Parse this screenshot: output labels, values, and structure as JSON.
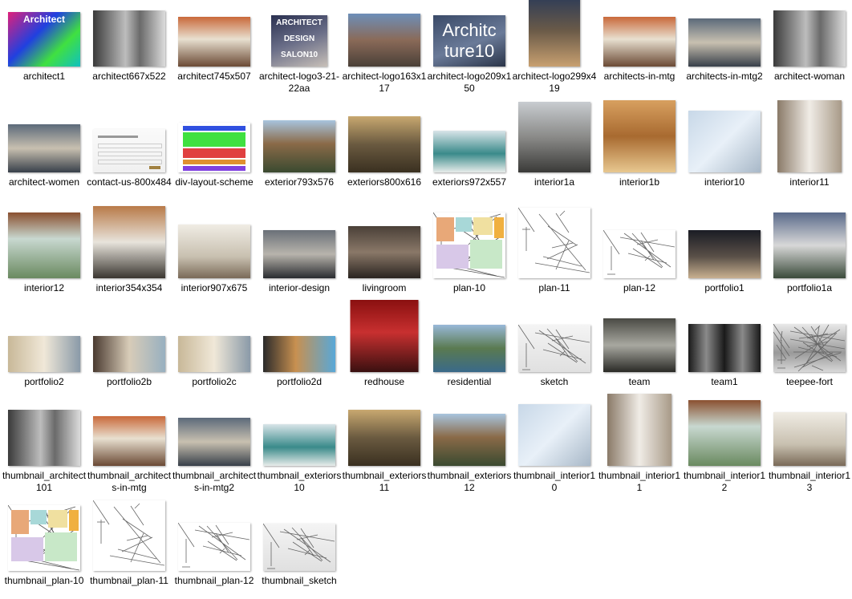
{
  "files": [
    {
      "name": "architect1",
      "kind": "neon"
    },
    {
      "name": "architect667x522",
      "kind": "bw"
    },
    {
      "name": "architect745x507",
      "kind": "office"
    },
    {
      "name": "architect-logo3-21-22aa",
      "kind": "logo3"
    },
    {
      "name": "architect-logo163x117",
      "kind": "city"
    },
    {
      "name": "architect-logo209x150",
      "kind": "logo20"
    },
    {
      "name": "architect-logo299x419",
      "kind": "tallhouse"
    },
    {
      "name": "architects-in-mtg",
      "kind": "office"
    },
    {
      "name": "architects-in-mtg2",
      "kind": "meeting"
    },
    {
      "name": "architect-woman",
      "kind": "bw"
    },
    {
      "name": "architect-women",
      "kind": "meeting"
    },
    {
      "name": "contact-us-800x484",
      "kind": "form"
    },
    {
      "name": "div-layout-scheme",
      "kind": "layout"
    },
    {
      "name": "exterior793x576",
      "kind": "exterior"
    },
    {
      "name": "exteriors800x616",
      "kind": "cabin"
    },
    {
      "name": "exteriors972x557",
      "kind": "teal"
    },
    {
      "name": "interior1a",
      "kind": "living"
    },
    {
      "name": "interior1b",
      "kind": "warm"
    },
    {
      "name": "interior10",
      "kind": "lightwall"
    },
    {
      "name": "interior11",
      "kind": "corridor"
    },
    {
      "name": "interior12",
      "kind": "balcony"
    },
    {
      "name": "interior354x354",
      "kind": "kitchen"
    },
    {
      "name": "interior907x675",
      "kind": "dining"
    },
    {
      "name": "interior-design",
      "kind": "sofa"
    },
    {
      "name": "livingroom",
      "kind": "fireplace"
    },
    {
      "name": "plan-10",
      "kind": "plancolor"
    },
    {
      "name": "plan-11",
      "kind": "section"
    },
    {
      "name": "plan-12",
      "kind": "plan"
    },
    {
      "name": "portfolio1",
      "kind": "nighthouse"
    },
    {
      "name": "portfolio1a",
      "kind": "modernhouse"
    },
    {
      "name": "portfolio2",
      "kind": "bedroom"
    },
    {
      "name": "portfolio2b",
      "kind": "bedroom2"
    },
    {
      "name": "portfolio2c",
      "kind": "bedroom"
    },
    {
      "name": "portfolio2d",
      "kind": "pool"
    },
    {
      "name": "redhouse",
      "kind": "red"
    },
    {
      "name": "residential",
      "kind": "lake"
    },
    {
      "name": "sketch",
      "kind": "sketch"
    },
    {
      "name": "team",
      "kind": "forest"
    },
    {
      "name": "team1",
      "kind": "faces"
    },
    {
      "name": "teepee-fort",
      "kind": "etching"
    },
    {
      "name": "thumbnail_architect101",
      "kind": "bw"
    },
    {
      "name": "thumbnail_architects-in-mtg",
      "kind": "office"
    },
    {
      "name": "thumbnail_architects-in-mtg2",
      "kind": "meeting"
    },
    {
      "name": "thumbnail_exteriors10",
      "kind": "teal"
    },
    {
      "name": "thumbnail_exteriors11",
      "kind": "cabin"
    },
    {
      "name": "thumbnail_exteriors12",
      "kind": "exterior"
    },
    {
      "name": "thumbnail_interior10",
      "kind": "lightwall"
    },
    {
      "name": "thumbnail_interior11",
      "kind": "corridor"
    },
    {
      "name": "thumbnail_interior12",
      "kind": "balcony"
    },
    {
      "name": "thumbnail_interior13",
      "kind": "dining"
    },
    {
      "name": "thumbnail_plan-10",
      "kind": "plancolor"
    },
    {
      "name": "thumbnail_plan-11",
      "kind": "section"
    },
    {
      "name": "thumbnail_plan-12",
      "kind": "plan"
    },
    {
      "name": "thumbnail_sketch",
      "kind": "sketch"
    }
  ],
  "thumb_text": {
    "architect1": "Architect",
    "logo3": [
      "ARCHITECT",
      "DESIGN",
      "SALON10"
    ],
    "logo20": [
      "Architc",
      "ture10"
    ]
  }
}
